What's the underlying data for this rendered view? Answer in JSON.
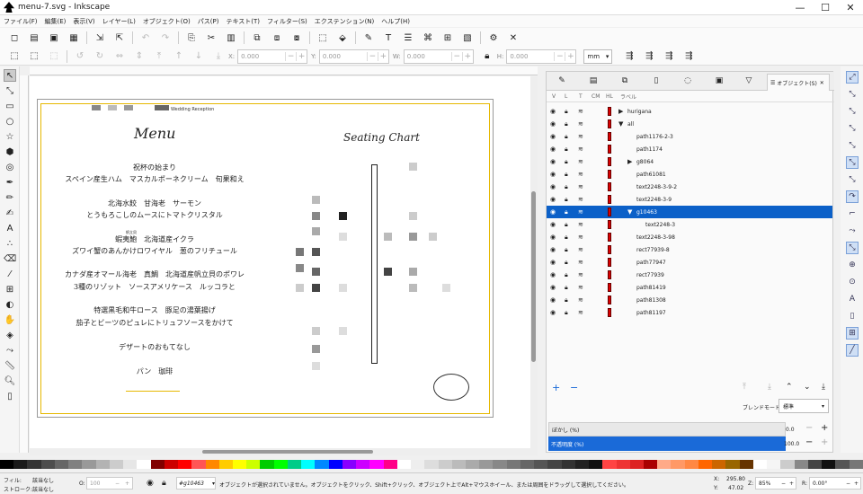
{
  "window": {
    "title": "menu-7.svg - Inkscape",
    "min": "—",
    "max": "☐",
    "close": "✕"
  },
  "menubar": [
    "ファイル(F)",
    "編集(E)",
    "表示(V)",
    "レイヤー(L)",
    "オブジェクト(O)",
    "パス(P)",
    "テキスト(T)",
    "フィルター(S)",
    "エクステンション(N)",
    "ヘルプ(H)"
  ],
  "toolbar2": {
    "x_label": "X:",
    "x_value": "0.000",
    "y_label": "Y:",
    "y_value": "0.000",
    "w_label": "W:",
    "w_value": "0.000",
    "h_label": "H:",
    "h_value": "0.000",
    "unit": "mm"
  },
  "canvas": {
    "wedding": "Wedding Reception",
    "menu_title": "Menu",
    "seating_title": "Seating Chart",
    "menu_lines": [
      "祝杯の始まり",
      "スペイン産生ハム　マスカルポーネクリーム　旬果和え",
      "北海水餃　甘海老　サーモン",
      "とうもろこしのムースにトマトクリスタル",
      "帆立貝",
      "蝦夷鮑　北海道産イクラ",
      "ズワイ蟹のあんかけロワイヤル　葱のフリチュール",
      "カナダ産オマール海老　真鯛　北海道産帆立貝のポワレ",
      "3種のリゾット　ソースアメリケース　ルッコラと",
      "特選黒毛和牛ロース　豚足の湯葉揚げ",
      "茄子とビーツのピュレにトリュフソースをかけて",
      "デザートのおもてなし",
      "パン　珈琲"
    ]
  },
  "dock": {
    "tab_label": "オブジェクト(S)",
    "columns": [
      "V",
      "L",
      "T",
      "CM",
      "HL",
      "ラベル"
    ],
    "objects": [
      {
        "name": "hurigana",
        "indent": 0,
        "arrow": "▶"
      },
      {
        "name": "all",
        "indent": 0,
        "arrow": "▼"
      },
      {
        "name": "path1176-2-3",
        "indent": 1,
        "arrow": ""
      },
      {
        "name": "path1174",
        "indent": 1,
        "arrow": ""
      },
      {
        "name": "g8064",
        "indent": 1,
        "arrow": "▶"
      },
      {
        "name": "path61081",
        "indent": 1,
        "arrow": ""
      },
      {
        "name": "text2248-3-9-2",
        "indent": 1,
        "arrow": ""
      },
      {
        "name": "text2248-3-9",
        "indent": 1,
        "arrow": ""
      },
      {
        "name": "g10463",
        "indent": 1,
        "arrow": "▼",
        "selected": true
      },
      {
        "name": "text2248-3",
        "indent": 2,
        "arrow": ""
      },
      {
        "name": "text2248-3-98",
        "indent": 1,
        "arrow": ""
      },
      {
        "name": "rect77939-8",
        "indent": 1,
        "arrow": ""
      },
      {
        "name": "path77947",
        "indent": 1,
        "arrow": ""
      },
      {
        "name": "rect77939",
        "indent": 1,
        "arrow": ""
      },
      {
        "name": "path81419",
        "indent": 1,
        "arrow": ""
      },
      {
        "name": "path81308",
        "indent": 1,
        "arrow": ""
      },
      {
        "name": "path81197",
        "indent": 1,
        "arrow": ""
      }
    ],
    "blend_label": "ブレンドモード:",
    "blend_value": "標準",
    "blur_label": "ぼかし (%)",
    "blur_value": "0.0",
    "opacity_label": "不透明度 (%)",
    "opacity_value": "100.0"
  },
  "status": {
    "fill_label": "フィル:",
    "fill_value": "該当なし",
    "stroke_label": "ストローク:",
    "stroke_value": "該当なし",
    "o_label": "O:",
    "o_value": "100",
    "layer": "#g10463",
    "message": "オブジェクトが選択されていません。オブジェクトをクリック、Shift+クリック、オブジェクト上でAlt+マウスホイール、または周囲をドラッグして選択してください。",
    "x_label": "X:",
    "x_value": "295.80",
    "y_label": "Y:",
    "y_value": "47.02",
    "zoom_label": "Z:",
    "zoom_value": "85%",
    "rot_label": "R:",
    "rot_value": "0.00°"
  }
}
